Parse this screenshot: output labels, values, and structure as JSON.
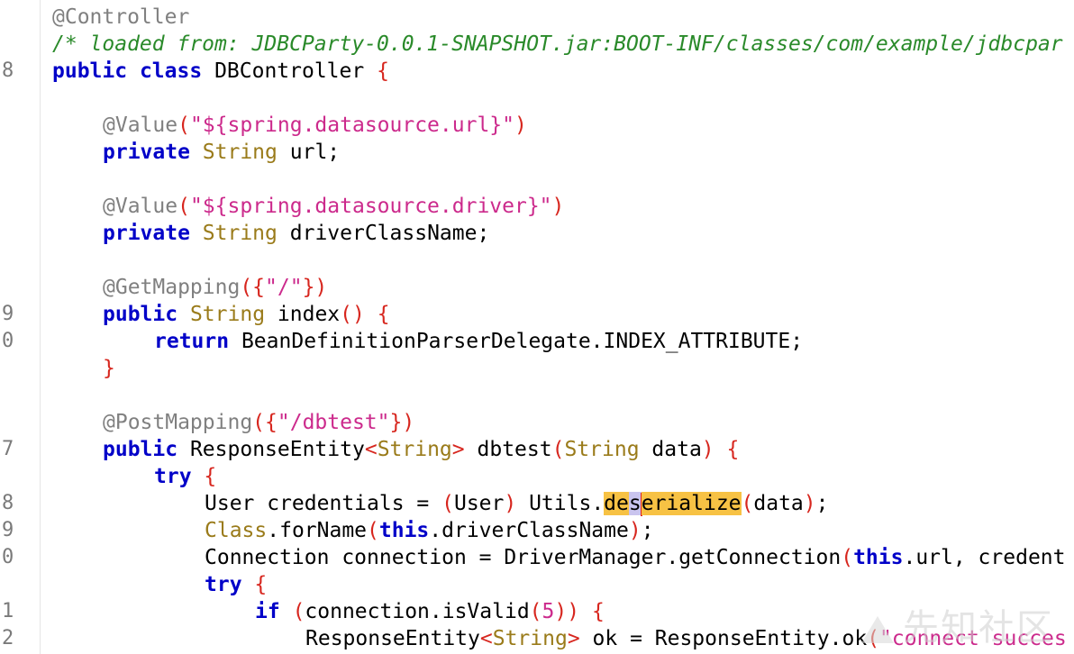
{
  "gutter": {
    "numbers": [
      "8",
      "9",
      "0",
      "7",
      "8",
      "9",
      "0",
      "1",
      "2"
    ]
  },
  "code": {
    "l1": {
      "ann": "@Controller"
    },
    "l2": {
      "comment": "/* loaded from: JDBCParty-0.0.1-SNAPSHOT.jar:BOOT-INF/classes/com/example/jdbcpar"
    },
    "l3": {
      "kw1": "public",
      "kw2": "class",
      "name": "DBController",
      "brace": "{"
    },
    "l5": {
      "ann": "@Value",
      "p1": "(",
      "str": "\"${spring.datasource.url}\"",
      "p2": ")"
    },
    "l6": {
      "kw": "private",
      "type": "String",
      "rest": "url;"
    },
    "l8": {
      "ann": "@Value",
      "p1": "(",
      "str": "\"${spring.datasource.driver}\"",
      "p2": ")"
    },
    "l9": {
      "kw": "private",
      "type": "String",
      "rest": "driverClassName;"
    },
    "l11": {
      "ann": "@GetMapping",
      "p1": "({",
      "str": "\"/\"",
      "p2": "})"
    },
    "l12": {
      "kw": "public",
      "type": "String",
      "name": "index",
      "paren": "()",
      "brace": "{"
    },
    "l13": {
      "kw": "return",
      "rest": "BeanDefinitionParserDelegate.INDEX_ATTRIBUTE;"
    },
    "l14": {
      "brace": "}"
    },
    "l16": {
      "ann": "@PostMapping",
      "p1": "({",
      "str": "\"/dbtest\"",
      "p2": "})"
    },
    "l17": {
      "kw": "public",
      "t1": "ResponseEntity",
      "lt": "<",
      "t2": "String",
      "gt": ">",
      "name": "dbtest",
      "p1": "(",
      "t3": "String",
      "arg": "data",
      "p2": ")",
      "brace": "{"
    },
    "l18": {
      "kw": "try",
      "brace": "{"
    },
    "l19": {
      "pre": "User credentials = ",
      "p1": "(",
      "cast": "User",
      "p2": ")",
      "obj": "Utils.",
      "h1": "de",
      "h2": "s",
      "h3": "erialize",
      "p3": "(",
      "arg": "data",
      "p4": ")",
      "end": ";"
    },
    "l20": {
      "type": "Class",
      "mid": ".forName",
      "p1": "(",
      "kw": "this",
      "rest": ".driverClassName",
      "p2": ")",
      "end": ";"
    },
    "l21": {
      "pre": "Connection connection = DriverManager.getConnection",
      "p1": "(",
      "kw": "this",
      "rest": ".url, credent"
    },
    "l22": {
      "kw": "try",
      "brace": "{"
    },
    "l23": {
      "kw": "if",
      "p1": "(",
      "rest": "connection.isValid",
      "p2": "(",
      "num": "5",
      "p3": "))",
      "brace": "{"
    },
    "l24": {
      "t1": "ResponseEntity",
      "lt": "<",
      "t2": "String",
      "gt": ">",
      "rest": " ok = ResponseEntity.ok",
      "p1": "(",
      "str": "\"connect succes"
    }
  },
  "watermark": {
    "text": "先知社区"
  },
  "colors": {
    "keyword": "#0000c8",
    "type": "#9a7b1a",
    "string": "#cc2a8c",
    "annotation": "#808080",
    "comment": "#2a8a2a",
    "bracket": "#d7261e",
    "highlight": "#f7c244",
    "highlight_secondary": "#c9c4ee",
    "caret": "#e0221d"
  }
}
